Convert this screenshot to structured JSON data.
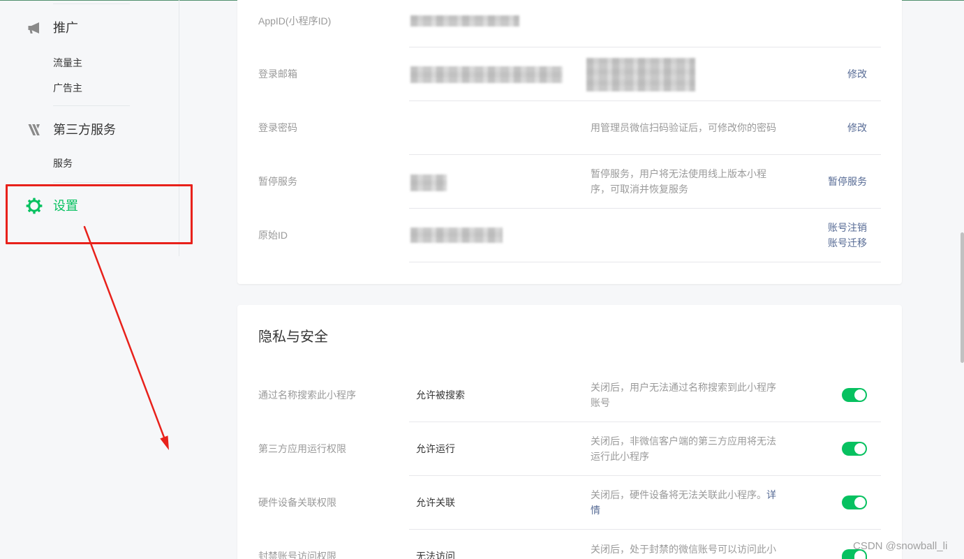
{
  "sidebar": {
    "promotion": {
      "title": "推广",
      "icon": "megaphone-icon",
      "items": [
        "流量主",
        "广告主"
      ]
    },
    "third_party": {
      "title": "第三方服务",
      "icon": "third-party-icon",
      "items": [
        "服务"
      ]
    },
    "settings": {
      "title": "设置",
      "icon": "gear-icon",
      "active": true
    }
  },
  "account_info": {
    "rows": [
      {
        "label": "AppID(小程序ID)"
      },
      {
        "label": "登录邮箱",
        "actions": [
          "修改"
        ]
      },
      {
        "label": "登录密码",
        "desc": "用管理员微信扫码验证后，可修改你的密码",
        "actions": [
          "修改"
        ]
      },
      {
        "label": "暂停服务",
        "desc": "暂停服务，用户将无法使用线上版本小程序，可取消并恢复服务",
        "actions": [
          "暂停服务"
        ]
      },
      {
        "label": "原始ID",
        "actions": [
          "账号注销",
          "账号迁移"
        ]
      }
    ]
  },
  "privacy": {
    "title": "隐私与安全",
    "rows": [
      {
        "label": "通过名称搜索此小程序",
        "value": "允许被搜索",
        "desc": "关闭后，用户无法通过名称搜索到此小程序账号",
        "enabled": true
      },
      {
        "label": "第三方应用运行权限",
        "value": "允许运行",
        "desc": "关闭后，非微信客户端的第三方应用将无法运行此小程序",
        "enabled": true
      },
      {
        "label": "硬件设备关联权限",
        "value": "允许关联",
        "desc": "关闭后，硬件设备将无法关联此小程序。",
        "desc_link": "详情",
        "enabled": true
      },
      {
        "label": "封禁账号访问权限",
        "value": "无法访问",
        "desc": "关闭后，处于封禁的微信账号可以访问此小",
        "enabled": true
      }
    ]
  },
  "watermark": "CSDN @snowball_li",
  "colors": {
    "accent": "#07c160",
    "link": "#576b95",
    "annotation": "#e8211b"
  }
}
